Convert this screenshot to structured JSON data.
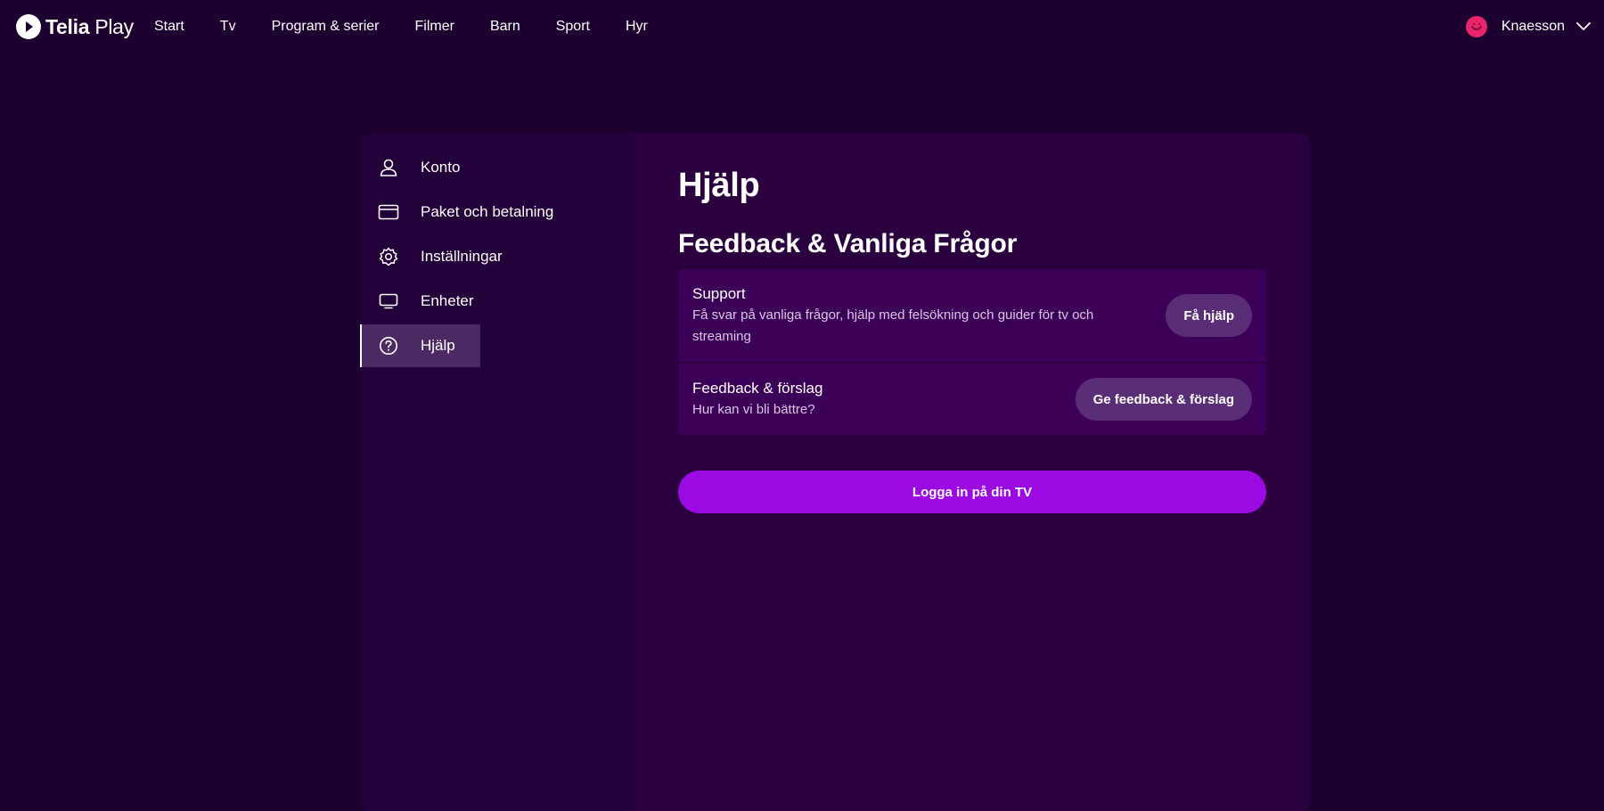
{
  "brand": {
    "name_bold": "Telia",
    "name_light": "Play"
  },
  "nav": {
    "items": [
      "Start",
      "Tv",
      "Program & serier",
      "Filmer",
      "Barn",
      "Sport",
      "Hyr"
    ]
  },
  "user": {
    "name": "Knaesson",
    "avatar_color": "#e8256b"
  },
  "sidebar": {
    "items": [
      {
        "label": "Konto",
        "icon": "user-icon"
      },
      {
        "label": "Paket och betalning",
        "icon": "credit-card-icon"
      },
      {
        "label": "Inställningar",
        "icon": "gear-icon"
      },
      {
        "label": "Enheter",
        "icon": "tv-icon"
      },
      {
        "label": "Hjälp",
        "icon": "help-circle-icon",
        "active": true
      }
    ]
  },
  "main": {
    "title": "Hjälp",
    "section_title": "Feedback & Vanliga Frågor",
    "rows": [
      {
        "title": "Support",
        "subtitle": "Få svar på vanliga frågor, hjälp med felsökning och guider för tv och streaming",
        "button": "Få hjälp"
      },
      {
        "title": "Feedback & förslag",
        "subtitle": "Hur kan vi bli bättre?",
        "button": "Ge feedback & förslag"
      }
    ],
    "primary_button": "Logga in på din TV"
  },
  "colors": {
    "background": "#1c0030",
    "card": "#2b003f",
    "sidebar": "#23003a",
    "row": "#3d0058",
    "pill": "#5a2d77",
    "primary": "#9b0ae3"
  }
}
